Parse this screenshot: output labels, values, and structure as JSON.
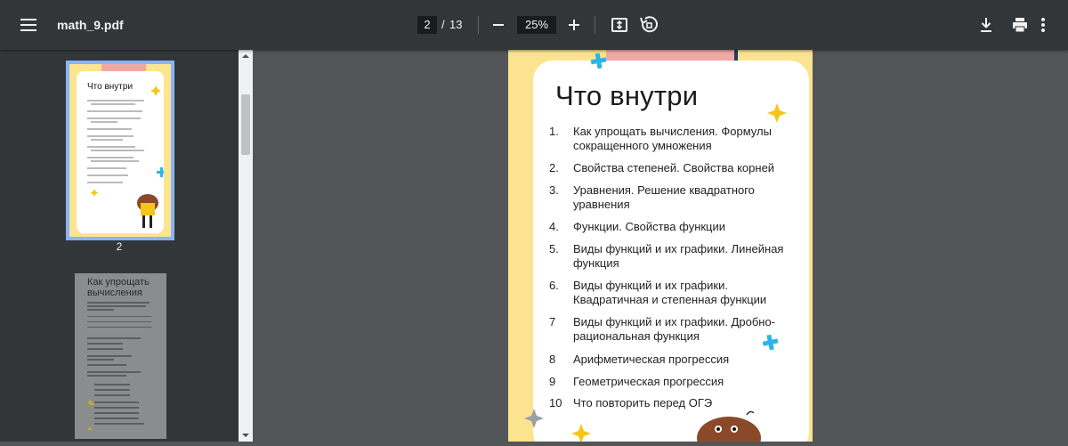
{
  "toolbar": {
    "file_name": "math_9.pdf",
    "current_page": "2",
    "page_separator": "/",
    "total_pages": "13",
    "zoom": "25%"
  },
  "sidebar": {
    "thumbnails": [
      {
        "page_label": "2",
        "title": "Что внутри"
      },
      {
        "title": "Как упрощать вычисления"
      }
    ]
  },
  "document": {
    "heading": "Что внутри",
    "toc": [
      {
        "num": "1.",
        "text": "Как упрощать вычисления. Формулы сокращенного умножения"
      },
      {
        "num": "2.",
        "text": "Свойства степеней. Свойства корней"
      },
      {
        "num": "3.",
        "text": "Уравнения. Решение квадратного уравнения"
      },
      {
        "num": "4.",
        "text": "Функции. Свойства функции"
      },
      {
        "num": "5.",
        "text": "Виды функций и их графики. Линейная функция"
      },
      {
        "num": "6.",
        "text": "Виды функций и их графики. Квадратичная и степенная функции"
      },
      {
        "num": "7",
        "text": "Виды функций и их графики. Дробно-рациональная функция"
      },
      {
        "num": "8",
        "text": "Арифметическая прогрессия"
      },
      {
        "num": "9",
        "text": "Геометрическая прогрессия"
      },
      {
        "num": "10",
        "text": "Что повторить перед ОГЭ"
      }
    ]
  },
  "colors": {
    "toolbar_bg": "#323639",
    "viewer_bg": "#525659",
    "page_border_yellow": "#fbe38f",
    "accent_cyan": "#29b6e8",
    "accent_gold": "#f5c518",
    "thumbnail_selected": "#8ab4f8"
  },
  "icons": [
    "menu-icon",
    "zoom-out-icon",
    "zoom-in-icon",
    "fit-page-icon",
    "rotate-icon",
    "download-icon",
    "print-icon",
    "more-vert-icon"
  ]
}
